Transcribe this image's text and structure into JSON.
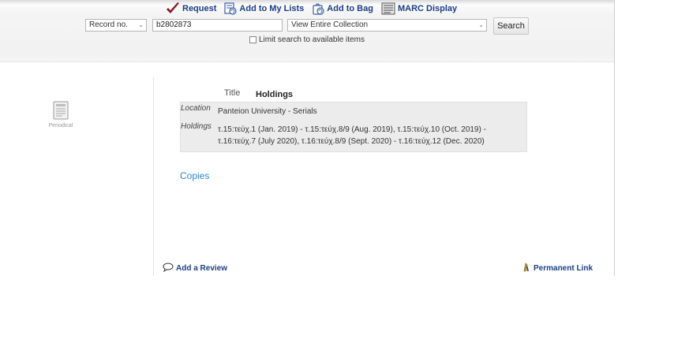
{
  "toolbar": {
    "request_label": "Request",
    "add_to_lists_label": "Add to My Lists",
    "add_to_bag_label": "Add to Bag",
    "marc_label": "MARC Display"
  },
  "search": {
    "field_type": "Record no.",
    "query_value": "b2802873",
    "collection": "View Entire Collection",
    "button_label": "Search",
    "limit_label": "Limit search to available items",
    "limit_checked": false
  },
  "record": {
    "format_label": "Periodical",
    "title_label": "Title",
    "title_value": "Holdings",
    "location_label": "Location",
    "location_value": "Panteion University - Serials",
    "holdings_label": "Holdings",
    "holdings_line1": "τ.15:τεύχ.1 (Jan. 2019) - τ.15:τεύχ.8/9 (Aug. 2019), τ.15:τεύχ.10 (Oct. 2019) -",
    "holdings_line2": "τ.16:τεύχ.7 (July 2020), τ.16:τεύχ.8/9 (Sept. 2020) - τ.16:τεύχ.12 (Dec. 2020)",
    "copies_label": "Copies"
  },
  "footer": {
    "review_label": "Add a Review",
    "permalink_label": "Permanent Link"
  },
  "colors": {
    "link_dark": "#1a3e86",
    "link_blue": "#2f86d6",
    "holdings_bg": "#ececec"
  }
}
